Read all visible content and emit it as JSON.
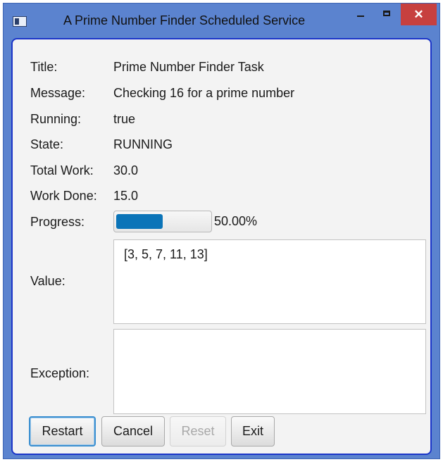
{
  "window": {
    "title": "A Prime Number Finder Scheduled Service",
    "close_glyph": "✕"
  },
  "fields": {
    "title_label": "Title:",
    "title_value": "Prime Number Finder Task",
    "message_label": "Message:",
    "message_value": "Checking 16 for a prime number",
    "running_label": "Running:",
    "running_value": "true",
    "state_label": "State:",
    "state_value": "RUNNING",
    "total_work_label": "Total Work:",
    "total_work_value": "30.0",
    "work_done_label": "Work Done:",
    "work_done_value": "15.0",
    "progress_label": "Progress:",
    "progress_fraction": 0.5,
    "progress_text": "50.00%",
    "value_label": "Value:",
    "value_text": "[3, 5, 7, 11, 13]",
    "exception_label": "Exception:",
    "exception_text": ""
  },
  "buttons": {
    "restart": "Restart",
    "cancel": "Cancel",
    "reset": "Reset",
    "exit": "Exit"
  },
  "colors": {
    "titlebar": "#5b83cf",
    "close_button": "#c7403f",
    "progress_fill": "#0b74b8",
    "focus_border": "#1b35c8"
  }
}
